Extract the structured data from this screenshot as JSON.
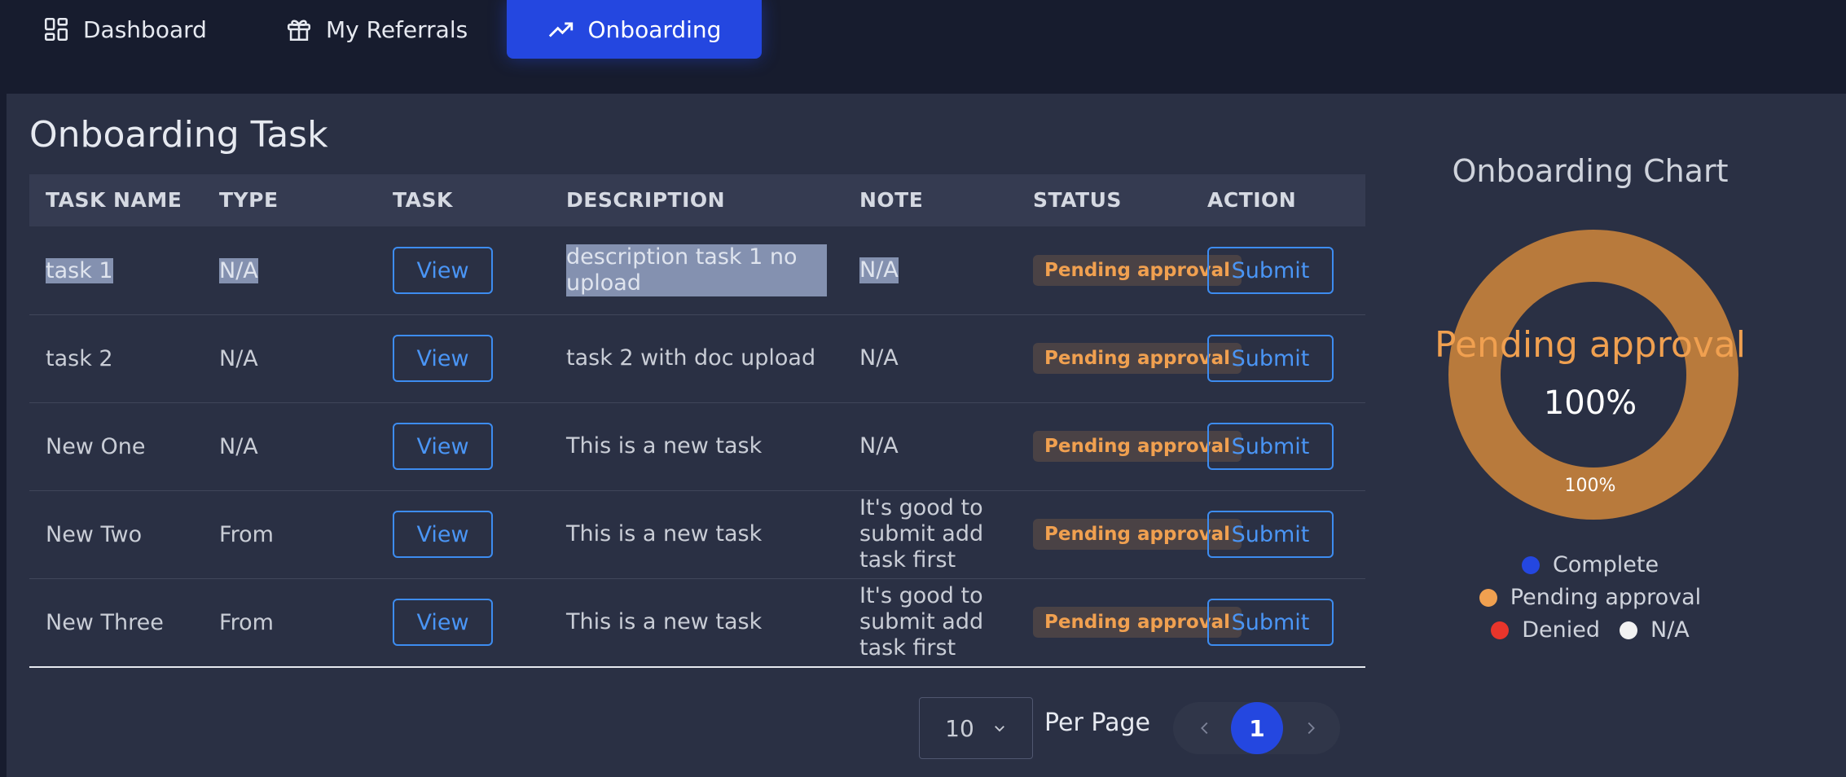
{
  "nav": {
    "tabs": [
      {
        "label": "Dashboard",
        "icon": "dashboard-grid-icon"
      },
      {
        "label": "My Referrals",
        "icon": "gift-icon"
      },
      {
        "label": "Onboarding",
        "icon": "trending-up-icon",
        "active": true
      }
    ]
  },
  "page": {
    "title": "Onboarding Task"
  },
  "table": {
    "headers": [
      "TASK NAME",
      "TYPE",
      "TASK",
      "DESCRIPTION",
      "NOTE",
      "STATUS",
      "ACTION"
    ],
    "view_label": "View",
    "submit_label": "Submit",
    "rows": [
      {
        "name": "task 1",
        "type": "N/A",
        "description": "description task 1 no upload",
        "note": "N/A",
        "status": "Pending approval",
        "selected": true
      },
      {
        "name": "task 2",
        "type": "N/A",
        "description": "task 2 with doc upload",
        "note": "N/A",
        "status": "Pending approval"
      },
      {
        "name": "New One",
        "type": "N/A",
        "description": "This is a new task",
        "note": "N/A",
        "status": "Pending approval"
      },
      {
        "name": "New Two",
        "type": "From",
        "description": "This is a new task",
        "note": "It's good to submit add task first",
        "status": "Pending approval"
      },
      {
        "name": "New Three",
        "type": "From",
        "description": "This is a new task",
        "note": "It's good to submit add task first",
        "status": "Pending approval"
      }
    ]
  },
  "pagination": {
    "per_page_value": "10",
    "per_page_label": "Per Page",
    "current_page": "1"
  },
  "chart_data": {
    "type": "pie",
    "title": "Onboarding Chart",
    "center_label": "Pending approval",
    "center_value": "100%",
    "slice_label": "100%",
    "categories": [
      "Complete",
      "Pending approval",
      "Denied",
      "N/A"
    ],
    "values": [
      0,
      100,
      0,
      0
    ],
    "colors": [
      "#2447e0",
      "#f0a050",
      "#e8352b",
      "#f2f2f2"
    ],
    "ring_color": "#b87a3c",
    "legend_position": "bottom"
  },
  "colors": {
    "accent": "#2447e0",
    "link": "#4a95f5",
    "pending": "#f0a050"
  }
}
